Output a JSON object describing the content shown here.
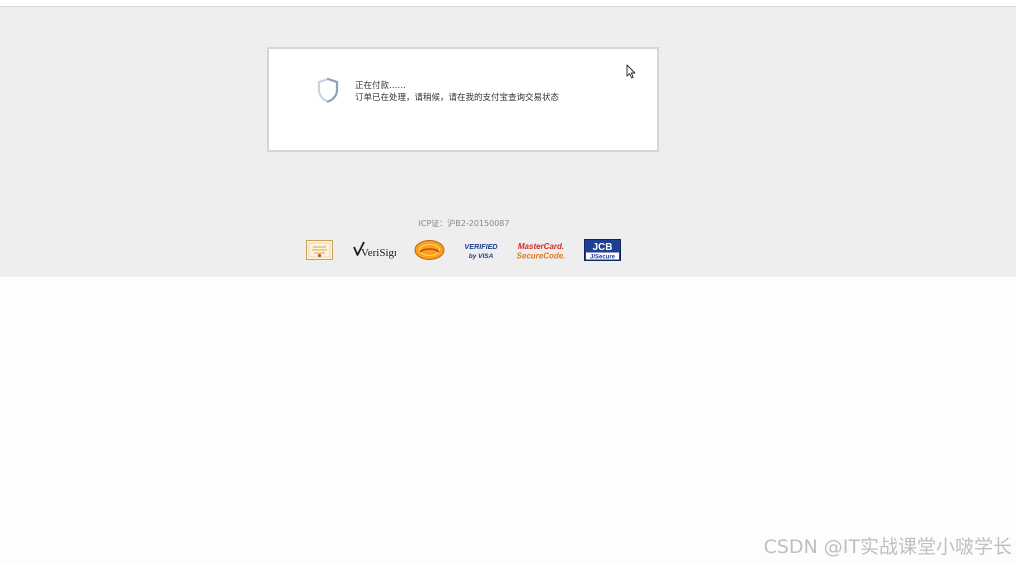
{
  "colors": {
    "page_bg": "#eeeeee",
    "card_border": "#d6d6d6",
    "text": "#333333",
    "muted": "#888888",
    "shield": "#8fa3b8"
  },
  "payment": {
    "status_title": "正在付款……",
    "status_detail": "订单已在处理，请稍候，请在我的支付宝查询交易状态"
  },
  "footer": {
    "icp": "ICP证：沪B2-20150087"
  },
  "trust_badges": {
    "verisign": "VeriSign",
    "verified_line1": "VERIFIED",
    "verified_line2": "by VISA",
    "mastercard_line1": "MasterCard.",
    "mastercard_line2": "SecureCode.",
    "jcb_line1": "JCB",
    "jcb_line2": "J/Secure"
  },
  "watermark": "CSDN @IT实战课堂小啵学长"
}
